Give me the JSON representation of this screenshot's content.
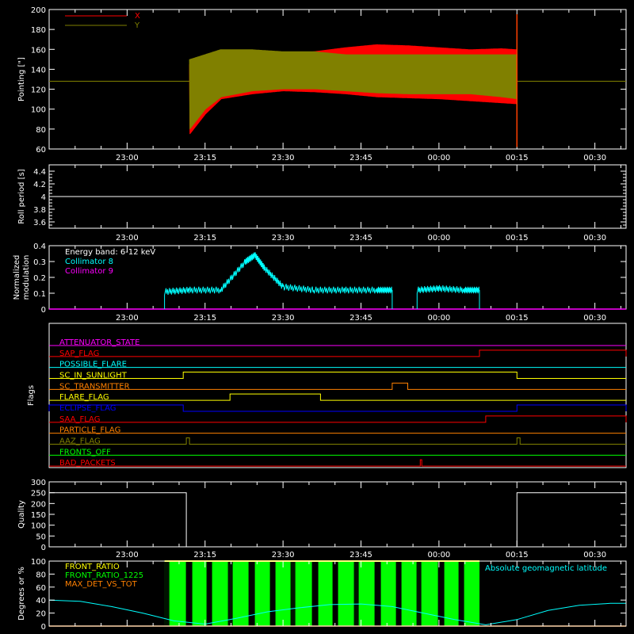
{
  "time_ticks": [
    "23:00",
    "23:15",
    "23:30",
    "23:45",
    "00:00",
    "00:15",
    "00:30"
  ],
  "time_range_hours": [
    22.75,
    24.6
  ],
  "chart_data": [
    {
      "id": "pointing",
      "type": "line",
      "ylabel": "Pointing [\"]",
      "ylim": [
        60,
        200
      ],
      "yticks": [
        60,
        80,
        100,
        120,
        140,
        160,
        180,
        200
      ],
      "legend_placement": "top-left",
      "baseline": 128,
      "span": [
        23.2,
        24.25
      ],
      "series": [
        {
          "name": "X",
          "color": "#ff0000",
          "x": [
            23.2,
            23.25,
            23.3,
            23.4,
            23.5,
            23.6,
            23.7,
            23.8,
            23.9,
            24.0,
            24.1,
            24.2,
            24.25
          ],
          "upper": [
            145,
            143,
            145,
            150,
            155,
            158,
            162,
            165,
            164,
            162,
            160,
            161,
            160
          ],
          "lower": [
            75,
            95,
            110,
            115,
            118,
            117,
            115,
            112,
            111,
            110,
            108,
            106,
            105
          ]
        },
        {
          "name": "Y",
          "color": "#808000",
          "x": [
            23.2,
            23.25,
            23.3,
            23.4,
            23.5,
            23.6,
            23.7,
            23.8,
            23.9,
            24.0,
            24.1,
            24.2,
            24.25
          ],
          "upper": [
            150,
            155,
            160,
            160,
            158,
            158,
            155,
            155,
            155,
            155,
            155,
            155,
            155
          ],
          "lower": [
            80,
            100,
            112,
            118,
            120,
            120,
            118,
            116,
            115,
            115,
            115,
            112,
            110
          ]
        }
      ]
    },
    {
      "id": "roll",
      "type": "line",
      "ylabel": "Roll period [s]",
      "ylim": [
        3.5,
        4.5
      ],
      "yticks": [
        3.6,
        3.8,
        4.0,
        4.2,
        4.4
      ],
      "series": [
        {
          "name": "",
          "color": "#ffffff",
          "x": [
            22.75,
            24.6
          ],
          "y": [
            4.0,
            4.0
          ]
        }
      ]
    },
    {
      "id": "modulation",
      "type": "line",
      "ylabel": "Normalized modulation",
      "ylim": [
        0,
        0.4
      ],
      "yticks": [
        0.0,
        0.1,
        0.2,
        0.3,
        0.4
      ],
      "annotation": "Energy band: 6-12 keV",
      "series": [
        {
          "name": "Collimator 8",
          "color": "#00ffff",
          "segments": [
            {
              "x": [
                23.12,
                23.2,
                23.3,
                23.38,
                23.41,
                23.44,
                23.5,
                23.6,
                23.7,
                23.8,
                23.85
              ],
              "y": [
                0.11,
                0.12,
                0.12,
                0.3,
                0.34,
                0.26,
                0.14,
                0.12,
                0.12,
                0.12,
                0.12
              ]
            },
            {
              "x": [
                23.93,
                24.0,
                24.08,
                24.13
              ],
              "y": [
                0.12,
                0.13,
                0.12,
                0.12
              ]
            }
          ]
        },
        {
          "name": "Collimator 9",
          "color": "#ff00ff",
          "x": [
            22.75,
            24.6
          ],
          "y": [
            0.0,
            0.0
          ]
        }
      ]
    },
    {
      "id": "flags",
      "type": "line",
      "ylabel": "Flags",
      "series": [
        {
          "name": "ATTENUATOR_STATE",
          "color": "#ff00ff",
          "on": []
        },
        {
          "name": "SAP_FLAG",
          "color": "#ff0000",
          "on": [
            [
              24.13,
              24.6
            ]
          ]
        },
        {
          "name": "POSSIBLE_FLARE",
          "color": "#00ffff",
          "on": []
        },
        {
          "name": "SC_IN_SUNLIGHT",
          "color": "#ffff00",
          "on": [
            [
              23.18,
              24.25
            ]
          ]
        },
        {
          "name": "SC_TRANSMITTER",
          "color": "#ff8000",
          "on": [
            [
              23.85,
              23.9
            ]
          ]
        },
        {
          "name": "FLARE_FLAG",
          "color": "#ffff00",
          "on": [
            [
              23.33,
              23.62
            ]
          ]
        },
        {
          "name": "ECLIPSE_FLAG",
          "color": "#0000ff",
          "on": [
            [
              22.75,
              23.18
            ],
            [
              24.25,
              24.6
            ]
          ]
        },
        {
          "name": "SAA_FLAG",
          "color": "#ff0000",
          "on": [
            [
              24.15,
              24.6
            ]
          ]
        },
        {
          "name": "PARTICLE_FLAG",
          "color": "#ff8000",
          "on": []
        },
        {
          "name": "AAZ_FLAG",
          "color": "#808000",
          "on": [
            [
              23.19,
              23.2
            ],
            [
              24.25,
              24.26
            ]
          ]
        },
        {
          "name": "FRONTS_OFF",
          "color": "#00ff00",
          "on": []
        },
        {
          "name": "BAD_PACKETS",
          "color": "#ff0000",
          "on": [
            [
              23.94,
              23.945
            ]
          ]
        }
      ]
    },
    {
      "id": "quality",
      "type": "line",
      "ylabel": "Quality",
      "ylim": [
        0,
        300
      ],
      "yticks": [
        0,
        50,
        100,
        150,
        200,
        250,
        300
      ],
      "series": [
        {
          "name": "",
          "color": "#ffffff",
          "x": [
            22.75,
            23.19,
            23.19,
            23.2,
            24.25,
            24.25,
            24.6
          ],
          "y": [
            250,
            250,
            0,
            0,
            0,
            250,
            250
          ]
        }
      ]
    },
    {
      "id": "geomag",
      "type": "line",
      "ylabel": "Degrees or %",
      "ylim": [
        0,
        100
      ],
      "yticks": [
        0,
        20,
        40,
        60,
        80,
        100
      ],
      "annotation": "Absolute geomagnetic latitude",
      "series": [
        {
          "name": "FRONT_RATIO",
          "color": "#ffff00",
          "x": [
            23.12,
            24.13
          ],
          "y": [
            100,
            100
          ]
        },
        {
          "name": "FRONT_RATIO_1225",
          "color": "#00ff00",
          "span": [
            23.12,
            24.13
          ]
        },
        {
          "name": "MAX_DET_VS_TOT",
          "color": "#ff8000",
          "x": [
            22.75,
            24.6
          ],
          "y": [
            0,
            0
          ]
        },
        {
          "name": "Absolute geomagnetic latitude",
          "color": "#00ffff",
          "x": [
            22.75,
            22.85,
            22.95,
            23.05,
            23.15,
            23.25,
            23.35,
            23.45,
            23.55,
            23.65,
            23.75,
            23.85,
            23.95,
            24.05,
            24.15,
            24.25,
            24.35,
            24.45,
            24.55,
            24.6
          ],
          "y": [
            40,
            38,
            30,
            20,
            8,
            3,
            12,
            22,
            28,
            33,
            34,
            30,
            20,
            10,
            2,
            10,
            24,
            32,
            35,
            35
          ]
        }
      ]
    }
  ]
}
